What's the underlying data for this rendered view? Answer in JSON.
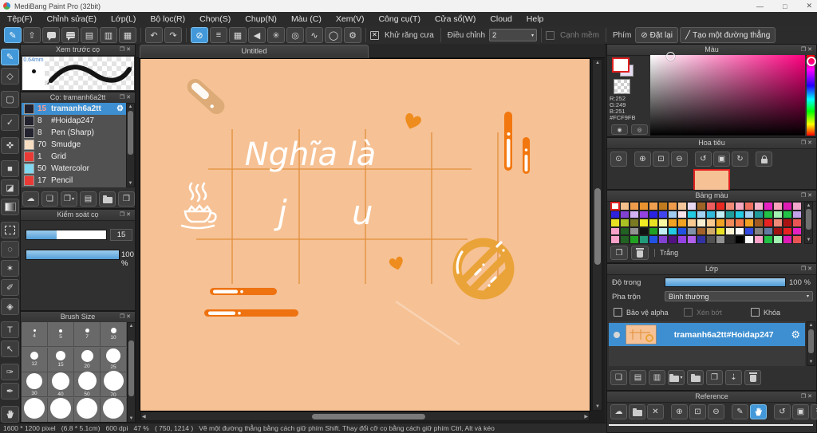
{
  "window": {
    "title": "MediBang Paint Pro (32bit)"
  },
  "icons": {
    "popout": "❐",
    "close": "✕",
    "up": "▲",
    "down": "▼",
    "left": "◀",
    "right": "▶",
    "caret": "▾",
    "check": "✕",
    "gear": "⚙",
    "undo": "↶",
    "redo": "↷",
    "minimize": "—",
    "maximize": "□",
    "winclose": "✕",
    "reset": "⊘",
    "line": "╱"
  },
  "menubar": {
    "items": [
      "Tệp(F)",
      "Chỉnh sửa(E)",
      "Lớp(L)",
      "Bộ lọc(R)",
      "Chọn(S)",
      "Chụp(N)",
      "Màu (C)",
      "Xem(V)",
      "Công cụ(T)",
      "Cửa sổ(W)",
      "Cloud",
      "Help"
    ]
  },
  "toolbar": {
    "file_icons": [
      {
        "name": "brush-mode-icon",
        "glyph": "✎",
        "active": true
      },
      {
        "name": "upload-icon",
        "glyph": "⇧"
      },
      {
        "name": "chat-icon",
        "type": "bubble"
      },
      {
        "name": "comment-icon",
        "type": "bubble2"
      },
      {
        "name": "document-icon",
        "glyph": "▤"
      },
      {
        "name": "material-list-icon",
        "glyph": "▥"
      },
      {
        "name": "tile-icon",
        "glyph": "▦"
      }
    ],
    "snap_icons": [
      {
        "name": "snap-off-icon",
        "glyph": "⊘",
        "active": true
      },
      {
        "name": "snap-parallel-icon",
        "glyph": "≡"
      },
      {
        "name": "snap-grid-icon",
        "glyph": "▦"
      },
      {
        "name": "snap-vanishing-icon",
        "glyph": "◀"
      },
      {
        "name": "snap-radial-icon",
        "glyph": "✳"
      },
      {
        "name": "snap-concentric-icon",
        "glyph": "◎"
      },
      {
        "name": "snap-curve-icon",
        "glyph": "∿"
      },
      {
        "name": "snap-ellipse-icon",
        "glyph": "◯"
      },
      {
        "name": "snap-settings-icon",
        "glyph": "⚙"
      }
    ],
    "antialias_label": "Khử răng cưa",
    "correction_label": "Điều chỉnh",
    "correction_value": "2",
    "soft_edge_label": "Cạnh mềm",
    "key_label": "Phím",
    "reset_label": "Đặt lại",
    "line_label": "Tạo một đường thẳng"
  },
  "tools": {
    "items": [
      {
        "name": "brush-tool",
        "glyph": "✎",
        "active": true
      },
      {
        "name": "eraser-tool",
        "glyph": "◇"
      },
      {
        "name": "shape-tool",
        "glyph": "▢",
        "gap": true
      },
      {
        "name": "polyline-tool",
        "glyph": "✓",
        "gap": true
      },
      {
        "name": "move-tool",
        "glyph": "✜",
        "gap": true
      },
      {
        "name": "fill-shape-tool",
        "glyph": "■",
        "gap": true
      },
      {
        "name": "bucket-tool",
        "glyph": "◪"
      },
      {
        "name": "gradient-tool",
        "type": "grad"
      },
      {
        "name": "select-tool",
        "type": "marquee",
        "gap": true
      },
      {
        "name": "lasso-tool",
        "glyph": "◌"
      },
      {
        "name": "magic-wand-tool",
        "glyph": "✶"
      },
      {
        "name": "select-pen-tool",
        "glyph": "✐"
      },
      {
        "name": "select-eraser-tool",
        "glyph": "◈"
      },
      {
        "name": "text-tool",
        "glyph": "T",
        "gap": true
      },
      {
        "name": "operation-tool",
        "glyph": "↖"
      },
      {
        "name": "divide-tool",
        "glyph": "✑",
        "gap": true
      },
      {
        "name": "eyedropper-tool",
        "glyph": "✒"
      },
      {
        "name": "hand-tool",
        "type": "hand",
        "gap": true
      }
    ]
  },
  "brush_preview": {
    "title": "Xem trước cọ",
    "size_label": "0.64mm"
  },
  "brushes": {
    "title": "Cọ: tramanh6a2tt",
    "items": [
      {
        "size": "15",
        "name": "tramanh6a2tt",
        "swatch": "#23232f",
        "selected": true
      },
      {
        "size": "8",
        "name": "#Hoidap247",
        "swatch": "#23232f"
      },
      {
        "size": "8",
        "name": "Pen (Sharp)",
        "swatch": "#23232f"
      },
      {
        "size": "70",
        "name": "Smudge",
        "swatch": "#f6dcc0"
      },
      {
        "size": "1",
        "name": "Grid",
        "swatch": "#e93a35"
      },
      {
        "size": "50",
        "name": "Watercolor",
        "swatch": "#7fd8ef"
      },
      {
        "size": "17",
        "name": "Pencil",
        "swatch": "#e93a35"
      }
    ],
    "footer_buttons": [
      {
        "name": "brush-cloud-download-button",
        "glyph": "☁"
      },
      {
        "name": "brush-new-button",
        "glyph": "❏"
      },
      {
        "name": "brush-add-image-button",
        "glyph": "❐",
        "caret": true
      },
      {
        "name": "brush-script-button",
        "glyph": "▤"
      },
      {
        "name": "brush-folder-button",
        "type": "folder"
      },
      {
        "name": "brush-duplicate-button",
        "glyph": "❒"
      }
    ]
  },
  "brush_control": {
    "title": "Kiểm soát cọ",
    "size_value": "15",
    "opacity_value": "100 %"
  },
  "brush_size": {
    "title": "Brush Size",
    "cells": [
      {
        "label": "4",
        "d": 3
      },
      {
        "label": "5",
        "d": 4
      },
      {
        "label": "7",
        "d": 5
      },
      {
        "label": "10",
        "d": 7
      },
      {
        "label": "12",
        "d": 10
      },
      {
        "label": "15",
        "d": 12
      },
      {
        "label": "20",
        "d": 15
      },
      {
        "label": "25",
        "d": 18
      },
      {
        "label": "30",
        "d": 20
      },
      {
        "label": "40",
        "d": 22
      },
      {
        "label": "50",
        "d": 23
      },
      {
        "label": "70",
        "d": 25
      },
      {
        "label": "",
        "d": 26
      },
      {
        "label": "",
        "d": 26
      },
      {
        "label": "",
        "d": 26
      },
      {
        "label": "",
        "d": 26
      }
    ]
  },
  "color": {
    "title": "Màu",
    "r": "R:252",
    "g": "G:249",
    "b": "B:251",
    "hex": "#FCF9FB",
    "buttons": [
      {
        "name": "color-wheel-button",
        "glyph": "◉"
      },
      {
        "name": "color-compare-button",
        "glyph": "◎"
      }
    ]
  },
  "navigator": {
    "title": "Hoa tiêu",
    "buttons": [
      {
        "name": "nav-zoom-100-button",
        "glyph": "⊙"
      },
      {
        "name": "nav-zoom-in-button",
        "glyph": "⊕",
        "gap": true
      },
      {
        "name": "nav-fit-screen-button",
        "glyph": "⊡"
      },
      {
        "name": "nav-zoom-out-button",
        "glyph": "⊖"
      },
      {
        "name": "nav-rotate-left-button",
        "glyph": "↺",
        "gap": true
      },
      {
        "name": "nav-rotate-reset-button",
        "glyph": "▣"
      },
      {
        "name": "nav-rotate-right-button",
        "glyph": "↻"
      },
      {
        "name": "nav-lock-button",
        "type": "lock",
        "gap": true
      }
    ]
  },
  "palette": {
    "title": "Bảng màu",
    "selected_name": "Trắng",
    "colors": [
      "#ffffff",
      "#f3c08c",
      "#ee9c4b",
      "#e9922f",
      "#ef9f50",
      "#c17b1e",
      "#ee9c4b",
      "#f3c79a",
      "#e7d9f1",
      "#9e6426",
      "#ef5e5e",
      "#e92a22",
      "#f28a78",
      "#f7a8c1",
      "#ef7061",
      "#f8b2ca",
      "#e621c4",
      "#f8a2bb",
      "#de1bb5",
      "#f2a6cb",
      "#2f22dd",
      "#8142d2",
      "#d2b2f2",
      "#9542e2",
      "#2b22e2",
      "#4244f0",
      "#a2cbf2",
      "#f8e2ea",
      "#22cbe2",
      "#a2d2f2",
      "#32bada",
      "#c2eef5",
      "#229b9b",
      "#22cbe2",
      "#a2d2f2",
      "#1f9b9b",
      "#22c246",
      "#a2f2b2",
      "#22c246",
      "#c2a2ea",
      "#e9e222",
      "#aac222",
      "#7a7a22",
      "#f2ea22",
      "#e9e222",
      "#f8f8a2",
      "#f2a222",
      "#f2a222",
      "#f8ca92",
      "#f8eed2",
      "#f8ca92",
      "#f2a222",
      "#f28a5a",
      "#f27a4a",
      "#f2a222",
      "#a25a22",
      "#e92222",
      "#f28a7a",
      "#aa1212",
      "#e95555",
      "#f8a2ca",
      "#226222",
      "#929292",
      "#121212",
      "#22a222",
      "#c2eef5",
      "#22cbe2",
      "#2252e2",
      "#8292aa",
      "#a2622a",
      "#d2aa6a",
      "#e9e222",
      "#f8f2d2",
      "#fafafa",
      "#3249e2",
      "#828282",
      "#627aa2",
      "#a21212",
      "#e92222",
      "#e621c4",
      "#f8a2ca",
      "#226222",
      "#22a222",
      "#229b7a",
      "#2252e2",
      "#8142d2",
      "#521282",
      "#9542e2",
      "#b262ea",
      "#3232a2",
      "#525252",
      "#929292",
      "#2a2a2a",
      "#000000",
      "#fafafa",
      "#f8a2ca",
      "#22c246",
      "#a2f2b2",
      "#de1bb5",
      "#e95555"
    ]
  },
  "layers": {
    "title": "Lớp",
    "opacity_label": "Độ trong",
    "opacity_value": "100 %",
    "blend_label": "Pha trộn",
    "blend_value": "Bình thường",
    "alpha_label": "Bảo vệ alpha",
    "clip_label": "Xén bớt",
    "lock_label": "Khóa",
    "layer_name": "tramanh6a2tt#Hoidap247",
    "buttons": [
      {
        "name": "layer-add-button",
        "glyph": "❏"
      },
      {
        "name": "layer-add-8bit-button",
        "glyph": "▤"
      },
      {
        "name": "layer-add-1bit-button",
        "glyph": "▥"
      },
      {
        "name": "layer-add-folder-button",
        "type": "folder",
        "caret": true
      },
      {
        "name": "layer-folder-button",
        "type": "folder"
      },
      {
        "name": "layer-duplicate-button",
        "glyph": "❐"
      },
      {
        "name": "layer-merge-button",
        "glyph": "⇣"
      },
      {
        "name": "layer-delete-button",
        "type": "trash"
      }
    ]
  },
  "reference": {
    "title": "Reference",
    "buttons": [
      {
        "name": "ref-cloud-button",
        "glyph": "☁"
      },
      {
        "name": "ref-open-folder-button",
        "type": "folder"
      },
      {
        "name": "ref-clear-button",
        "glyph": "✕"
      },
      {
        "name": "ref-zoom-in-button",
        "glyph": "⊕",
        "gap": true
      },
      {
        "name": "ref-fit-button",
        "glyph": "⊡"
      },
      {
        "name": "ref-zoom-out-button",
        "glyph": "⊖"
      },
      {
        "name": "ref-eyedropper-button",
        "glyph": "✎",
        "gap": true
      },
      {
        "name": "ref-hand-button",
        "type": "hand",
        "active": true
      },
      {
        "name": "ref-rotate-left-button",
        "glyph": "↺",
        "gap": true
      },
      {
        "name": "ref-rotate-reset-button",
        "glyph": "▣"
      },
      {
        "name": "ref-rotate-right-button",
        "glyph": "↻"
      }
    ]
  },
  "canvas": {
    "tab": "Untitled",
    "text_line1": "Nghĩa là",
    "text_line2": "j u"
  },
  "statusbar": {
    "text": "1600 * 1200 pixel   (6.8 * 5.1cm)   600 dpi   47 %   ( 750, 1214 )   Vẽ một đường thẳng bằng cách giữ phím Shift. Thay đổi cỡ cọ bằng cách giữ phím Ctrl, Alt và kéo"
  }
}
